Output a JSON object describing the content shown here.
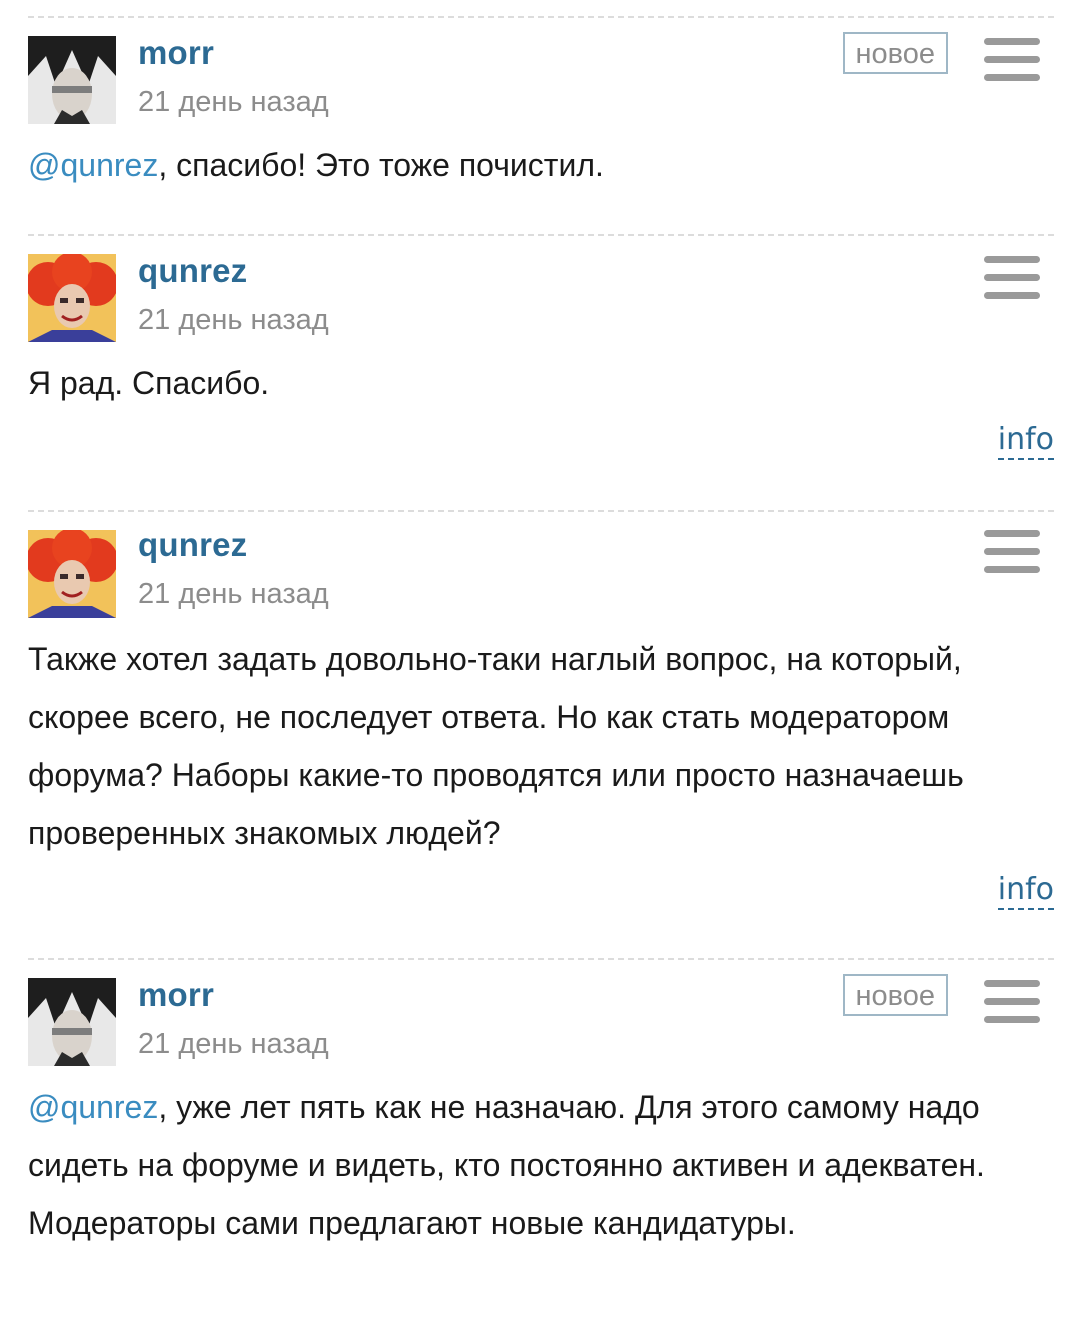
{
  "comments": [
    {
      "author": "morr",
      "time": "21 день назад",
      "badge": "новое",
      "mention": "@qunrez",
      "text": ", спасибо! Это тоже почистил."
    },
    {
      "author": "qunrez",
      "time": "21 день назад",
      "text": "Я рад. Спасибо.",
      "info": "info"
    },
    {
      "author": "qunrez",
      "time": "21 день назад",
      "text": "Также хотел задать довольно-таки наглый вопрос, на который, скорее всего, не последует ответа. Но как стать модератором форума? Наборы какие-то проводятся или просто назначаешь проверенных знакомых людей?",
      "info": "info"
    },
    {
      "author": "morr",
      "time": "21 день назад",
      "badge": "новое",
      "mention": "@qunrez",
      "text": ", уже лет пять как не назначаю. Для этого самому надо сидеть на форуме и видеть, кто постоянно активен и адекватен. Модераторы сами предлагают новые кандидатуры."
    }
  ],
  "icons": {
    "menu": "hamburger-menu-icon",
    "avatar_morr": "anime-character-avatar",
    "avatar_qunrez": "red-hair-clown-avatar"
  },
  "colors": {
    "author": "#2c6a93",
    "mention": "#3a8cc0",
    "time": "#8c8c8c",
    "badge_border": "#9fb7c6"
  }
}
